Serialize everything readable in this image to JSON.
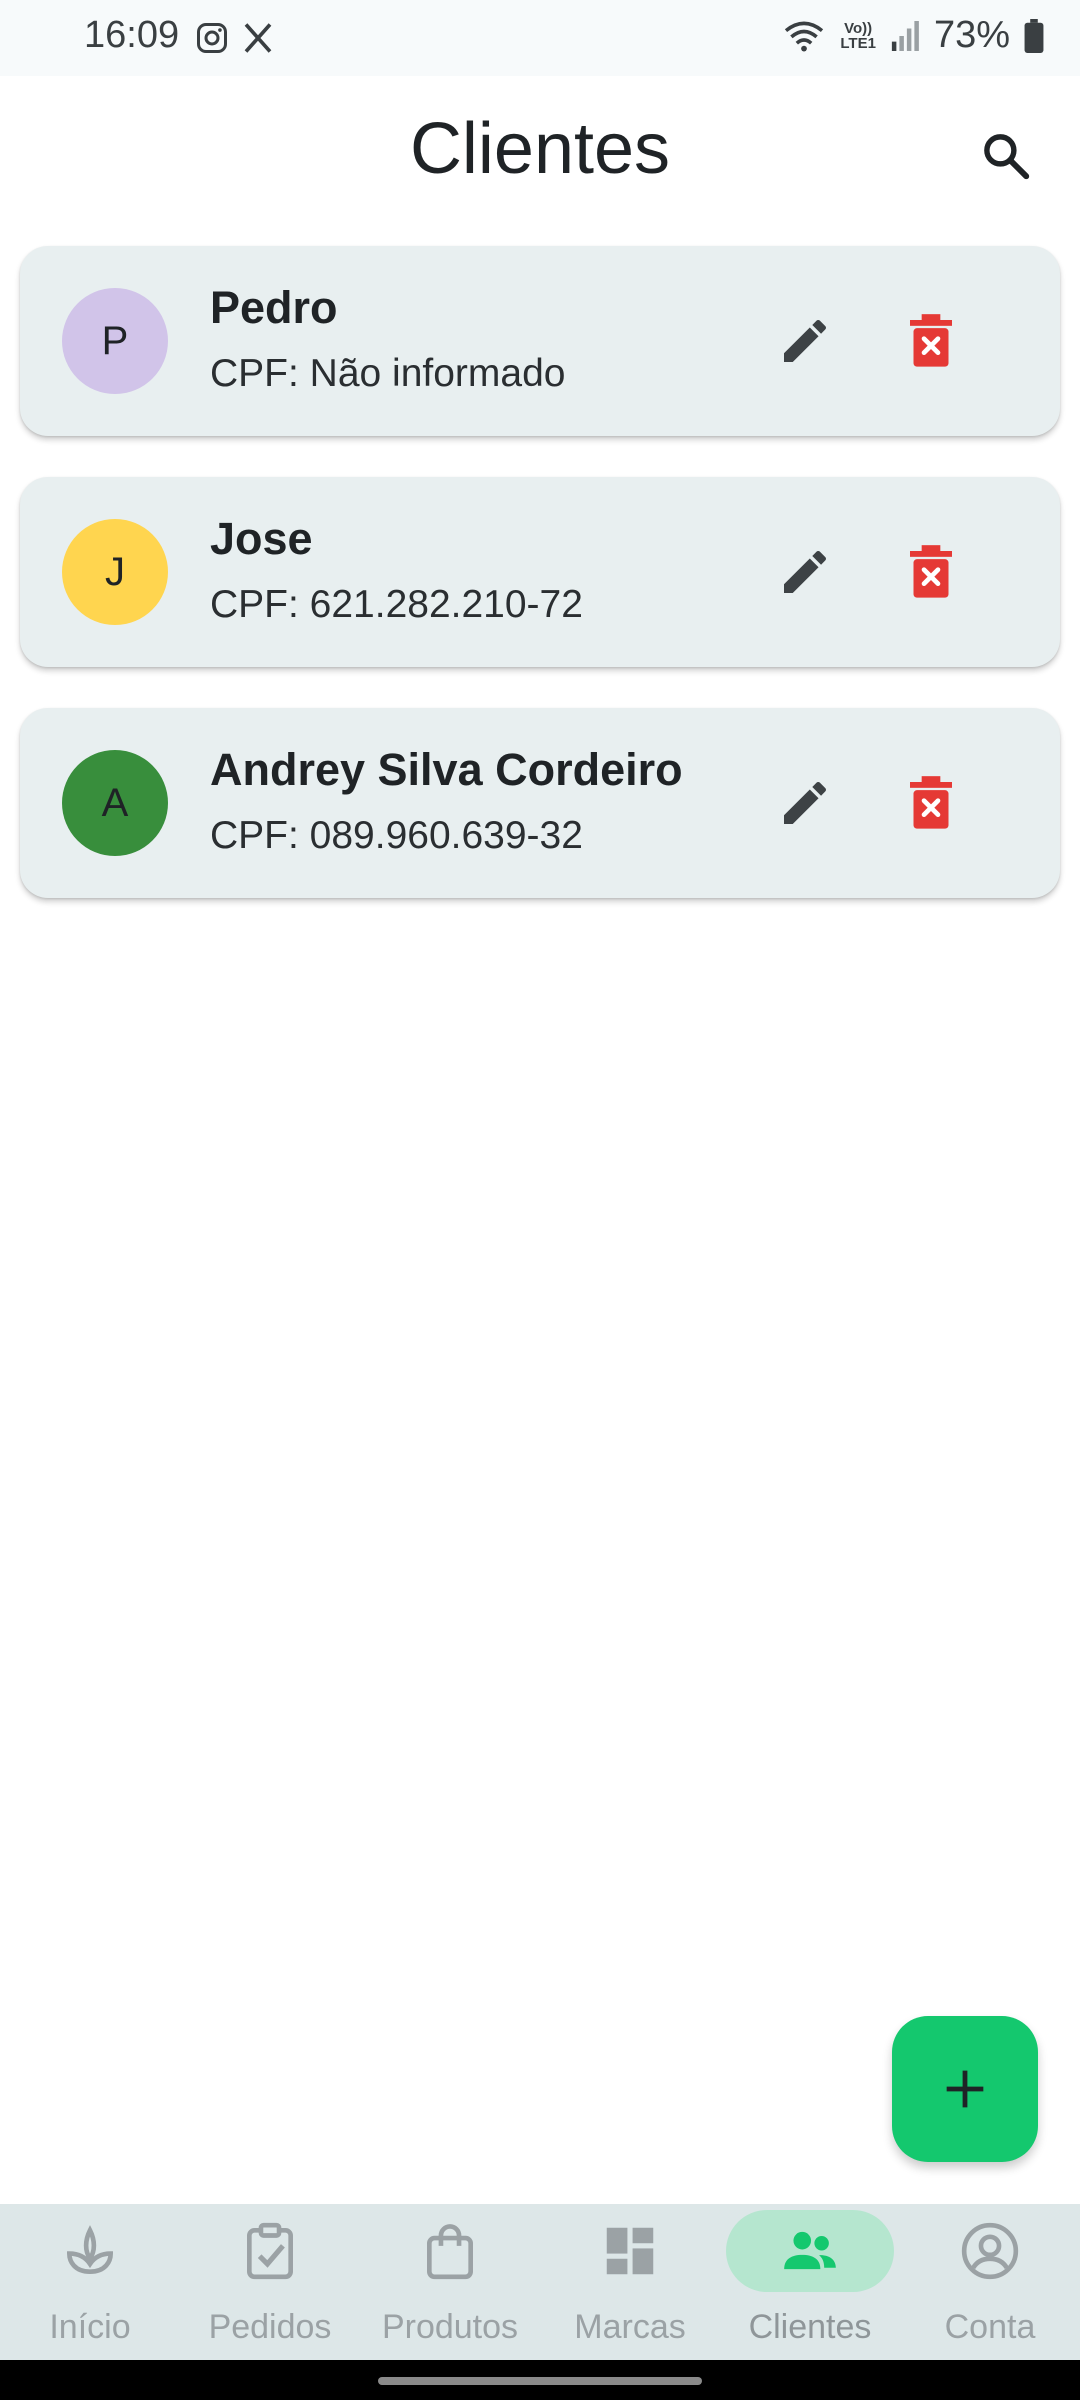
{
  "status_bar": {
    "time": "16:09",
    "app_icons": [
      "instagram-icon",
      "x-icon"
    ],
    "network_label_top": "Vo))",
    "network_label_bottom": "LTE1",
    "battery": "73%"
  },
  "app_bar": {
    "title": "Clientes",
    "search_icon": "search-icon"
  },
  "clients": [
    {
      "initial": "P",
      "name": "Pedro",
      "cpf": "CPF: Não informado",
      "avatar_color": "#d1c4e9"
    },
    {
      "initial": "J",
      "name": "Jose",
      "cpf": "CPF: 621.282.210-72",
      "avatar_color": "#ffd54f"
    },
    {
      "initial": "A",
      "name": "Andrey Silva Cordeiro",
      "cpf": "CPF: 089.960.639-32",
      "avatar_color": "#388e3c"
    }
  ],
  "actions": {
    "edit_icon": "pencil-icon",
    "delete_icon": "trash-icon",
    "edit_color": "#3d4245",
    "delete_color": "#e53935"
  },
  "fab": {
    "icon": "plus-icon",
    "color": "#14c86e"
  },
  "bottom_nav": {
    "items": [
      {
        "label": "Início",
        "icon": "sprout-icon",
        "active": false
      },
      {
        "label": "Pedidos",
        "icon": "clipboard-check-icon",
        "active": false
      },
      {
        "label": "Produtos",
        "icon": "shopping-bag-icon",
        "active": false
      },
      {
        "label": "Marcas",
        "icon": "dashboard-icon",
        "active": false
      },
      {
        "label": "Clientes",
        "icon": "people-icon",
        "active": true
      },
      {
        "label": "Conta",
        "icon": "account-circle-icon",
        "active": false
      }
    ]
  },
  "colors": {
    "accent": "#14c86e",
    "card_bg": "#e8eff0",
    "nav_bg": "#dde7e8",
    "nav_active_pill": "#b5e6cf"
  }
}
